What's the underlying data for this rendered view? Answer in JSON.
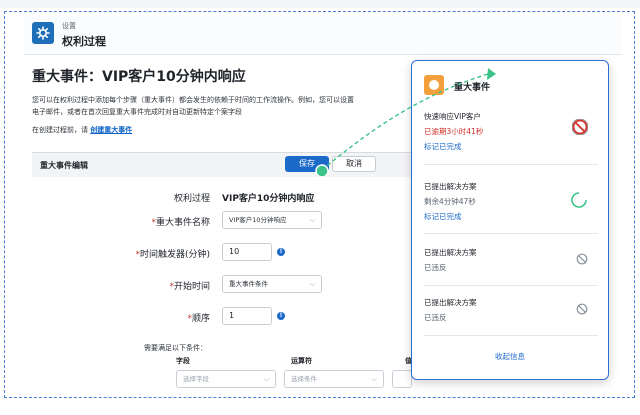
{
  "header": {
    "breadcrumb": "设置",
    "title": "权利过程"
  },
  "main": {
    "title": "重大事件：VIP客户10分钟内响应",
    "description_line1": "您可以在权利过程中添加每个步骤（重大事件）都会发生的依赖于时间的工作流操作。例如，您可以设置",
    "description_line2": "电子邮件，或者在首次回复重大事件完成时对自动更新特定个案字段",
    "note_prefix": "在创建过程前，请",
    "note_link": "创建重大事件"
  },
  "editor": {
    "title": "重大事件编辑",
    "save_label": "保存",
    "cancel_label": "取消",
    "fields": {
      "process_label": "权利过程",
      "process_value": "VIP客户10分钟内响应",
      "milestone_label": "重大事件名称",
      "milestone_value": "VIP客户10分钟响应",
      "trigger_label": "时间触发器(分钟)",
      "trigger_value": "10",
      "start_label": "开始时间",
      "start_value": "重大事件条件",
      "order_label": "顺序",
      "order_value": "1"
    },
    "conditions_title": "需要满足以下条件：",
    "columns": {
      "field": "字段",
      "operator": "运算符",
      "value": "值"
    },
    "field_placeholder": "选择字段",
    "operator_placeholder": "选择条件"
  },
  "popup": {
    "title": "重大事件",
    "items": [
      {
        "name": "快速响应VIP客户",
        "status": "已逾期3小时41秒",
        "link": "标记已完成",
        "icon": "blocked-icon"
      },
      {
        "name": "已提出解决方案",
        "status": "剩余4分钟47秒",
        "link": "标记已完成",
        "icon": "spinner-icon"
      },
      {
        "name": "已提出解决方案",
        "status": "已违反",
        "icon": "disabled-icon"
      },
      {
        "name": "已提出解决方案",
        "status": "已违反",
        "icon": "disabled-icon"
      }
    ],
    "footer": "收起信息"
  },
  "colors": {
    "accent": "#1b6ac9",
    "overdue": "#d0312d",
    "connector": "#3cc38a",
    "frame": "#4a7fd4"
  }
}
